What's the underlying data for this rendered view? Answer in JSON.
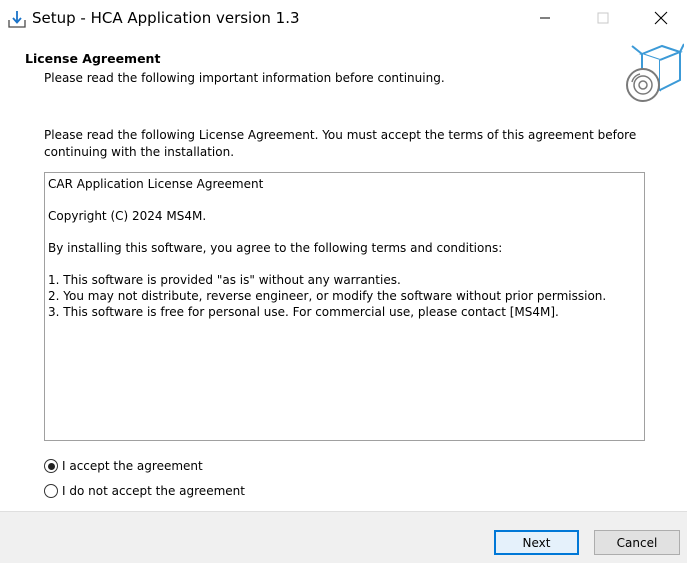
{
  "window": {
    "title": "Setup - HCA Application version 1.3"
  },
  "header": {
    "heading": "License Agreement",
    "subheading": "Please read the following important information before continuing."
  },
  "intro_text": "Please read the following License Agreement. You must accept the terms of this agreement before continuing with the installation.",
  "license": {
    "lines": [
      "CAR Application License Agreement",
      "Copyright (C) 2024 MS4M.",
      "By installing this software, you agree to the following terms and conditions:",
      "1. This software is provided \"as is\" without any warranties.",
      "2. You may not distribute, reverse engineer, or modify the software without prior permission.",
      "3. This software is free for personal use. For commercial use, please contact [MS4M]."
    ]
  },
  "options": {
    "accept_label": "I accept the agreement",
    "decline_label": "I do not accept the agreement",
    "selected": "accept"
  },
  "buttons": {
    "next_label": "Next",
    "cancel_label": "Cancel"
  },
  "icons": {
    "app": "setup-download-icon",
    "wizard": "box-disc-icon",
    "minimize": "minimize-icon",
    "maximize": "maximize-icon",
    "close": "close-icon"
  },
  "colors": {
    "accent": "#0078d7",
    "footer_bg": "#f0f0f0",
    "wizard_icon": "#3c9ad7"
  }
}
